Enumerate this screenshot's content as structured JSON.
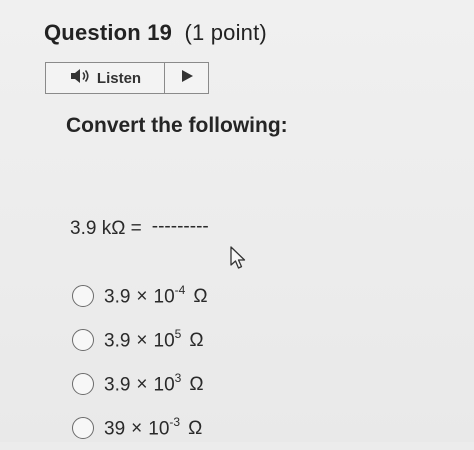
{
  "question": {
    "title": "Question 19",
    "points": "(1 point)"
  },
  "listen": {
    "label": "Listen",
    "speaker_icon": "speaker-icon",
    "play_icon": "play-icon"
  },
  "prompt": "Convert the following:",
  "equation": {
    "lhs": "3.9 kΩ =",
    "blank": "---------"
  },
  "options": [
    {
      "coef": "3.9",
      "mult": "×",
      "base": "10",
      "exp": "-4",
      "unit": "Ω"
    },
    {
      "coef": "3.9",
      "mult": "×",
      "base": "10",
      "exp": "5",
      "unit": "Ω"
    },
    {
      "coef": "3.9",
      "mult": "×",
      "base": "10",
      "exp": "3",
      "unit": "Ω"
    },
    {
      "coef": "39",
      "mult": "×",
      "base": "10",
      "exp": "-3",
      "unit": "Ω"
    }
  ]
}
